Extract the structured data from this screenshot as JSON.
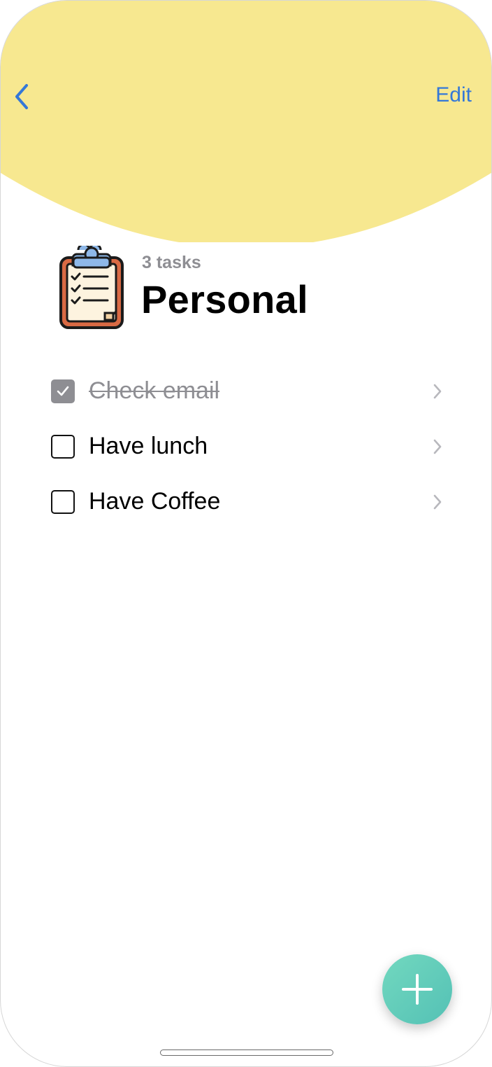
{
  "header": {
    "back_icon": "chevron-left-icon",
    "edit_label": "Edit",
    "accent_color": "#3478d8",
    "background_color": "#f7e890"
  },
  "list": {
    "icon": "clipboard-checklist-icon",
    "task_count": "3 tasks",
    "title": "Personal"
  },
  "tasks": [
    {
      "label": "Check email",
      "completed": true
    },
    {
      "label": "Have lunch",
      "completed": false
    },
    {
      "label": "Have Coffee",
      "completed": false
    }
  ],
  "fab": {
    "icon": "plus-icon",
    "color": "#5fcbbb"
  }
}
